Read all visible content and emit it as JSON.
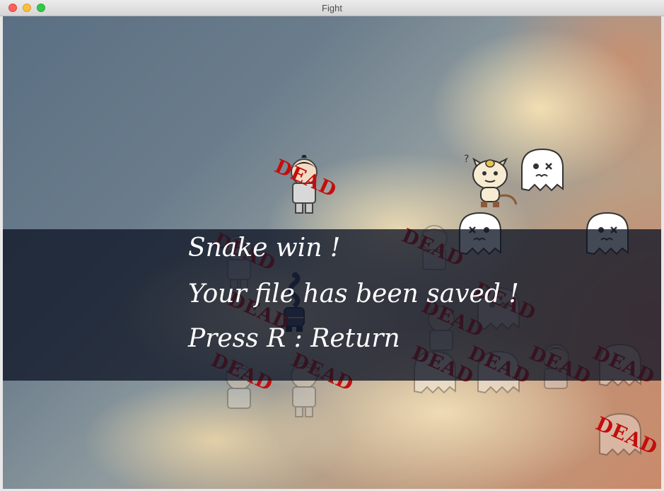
{
  "window": {
    "title": "Fight"
  },
  "game": {
    "messages": {
      "winner": "Snake win !",
      "saved": "Your file has been saved !",
      "hint": "Press R : Return"
    },
    "dead_label": "DEAD",
    "colors": {
      "dead_text": "#c40d0d",
      "overlay": "#101626",
      "message_text": "#ffffff"
    },
    "sprites": [
      {
        "kind": "warrior",
        "status": "dead"
      },
      {
        "kind": "cat",
        "status": "alive"
      },
      {
        "kind": "ghost",
        "status": "alive"
      },
      {
        "kind": "ghost",
        "status": "alive"
      },
      {
        "kind": "ghost",
        "status": "alive"
      },
      {
        "kind": "snake",
        "status": "winner"
      },
      {
        "kind": "warrior",
        "status": "dead"
      },
      {
        "kind": "warrior",
        "status": "dead"
      },
      {
        "kind": "warrior",
        "status": "dead"
      },
      {
        "kind": "warrior",
        "status": "dead"
      },
      {
        "kind": "ghost",
        "status": "dead"
      },
      {
        "kind": "ghost",
        "status": "dead"
      },
      {
        "kind": "ghost",
        "status": "dead"
      },
      {
        "kind": "ghost",
        "status": "dead"
      },
      {
        "kind": "ghost",
        "status": "dead"
      }
    ]
  }
}
